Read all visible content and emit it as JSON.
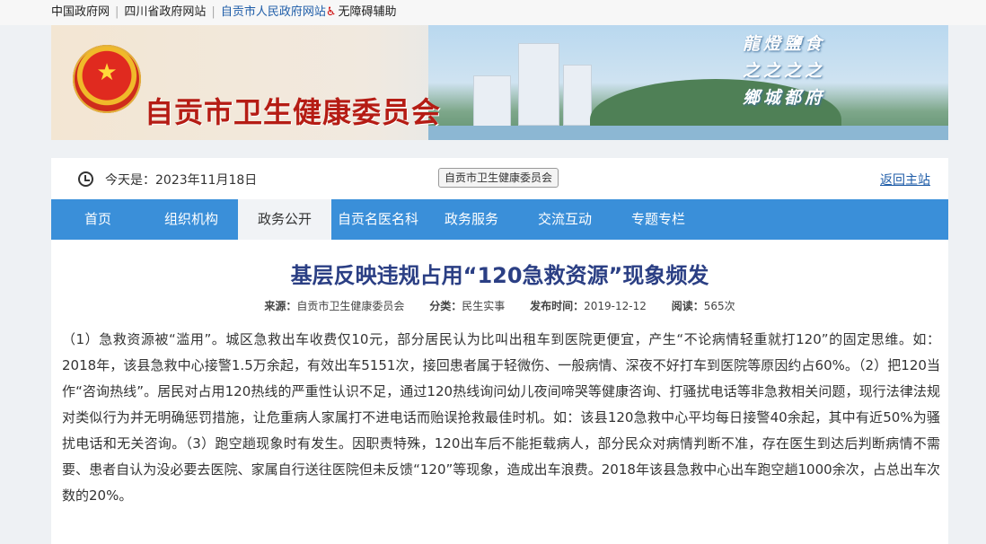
{
  "toplinks": {
    "link1": "中国政府网",
    "link2": "四川省政府网站",
    "link3": "自贡市人民政府网站",
    "accessibility": "无障碍辅助",
    "accessibility_icon": "wheelchair-icon"
  },
  "banner": {
    "title": "自贡市卫生健康委员会",
    "slogan_col1": "龍燈鹽食",
    "slogan_col2": "之之之之",
    "slogan_col3": "鄉城都府"
  },
  "infobar": {
    "date_text": "今天是：2023年11月18日",
    "site_box": "自贡市卫生健康委员会",
    "back_link": "返回主站"
  },
  "nav": {
    "items": [
      "首页",
      "组织机构",
      "政务公开",
      "自贡名医名科",
      "政务服务",
      "交流互动",
      "专题专栏"
    ],
    "active_index": 2
  },
  "article": {
    "title": "基层反映违规占用“120急救资源”现象频发",
    "meta": {
      "source_label": "来源：",
      "source": "自贡市卫生健康委员会",
      "category_label": "分类：",
      "category": "民生实事",
      "date_label": "发布时间：",
      "date": "2019-12-12",
      "views_label": "阅读：",
      "views": "565次"
    },
    "body": "（1）急救资源被“滥用”。城区急救出车收费仅10元，部分居民认为比叫出租车到医院更便宜，产生“不论病情轻重就打120”的固定思维。如：2018年，该县急救中心接警1.5万余起，有效出车5151次，接回患者属于轻微伤、一般病情、深夜不好打车到医院等原因约占60%。（2）把120当作“咨询热线”。居民对占用120热线的严重性认识不足，通过120热线询问幼儿夜间啼哭等健康咨询、打骚扰电话等非急救相关问题，现行法律法规对类似行为并无明确惩罚措施，让危重病人家属打不进电话而贻误抢救最佳时机。如：该县120急救中心平均每日接警40余起，其中有近50%为骚扰电话和无关咨询。（3）跑空趟现象时有发生。因职责特殊，120出车后不能拒载病人，部分民众对病情判断不准，存在医生到达后判断病情不需要、患者自认为没必要去医院、家属自行送往医院但未反馈“120”等现象，造成出车浪费。2018年该县急救中心出车跑空趟1000余次，占总出车次数的20%。"
  },
  "colors": {
    "nav_bg": "#3a8fd9",
    "title": "#2b3f84",
    "banner_title": "#b51c14",
    "link": "#1f5da8"
  }
}
